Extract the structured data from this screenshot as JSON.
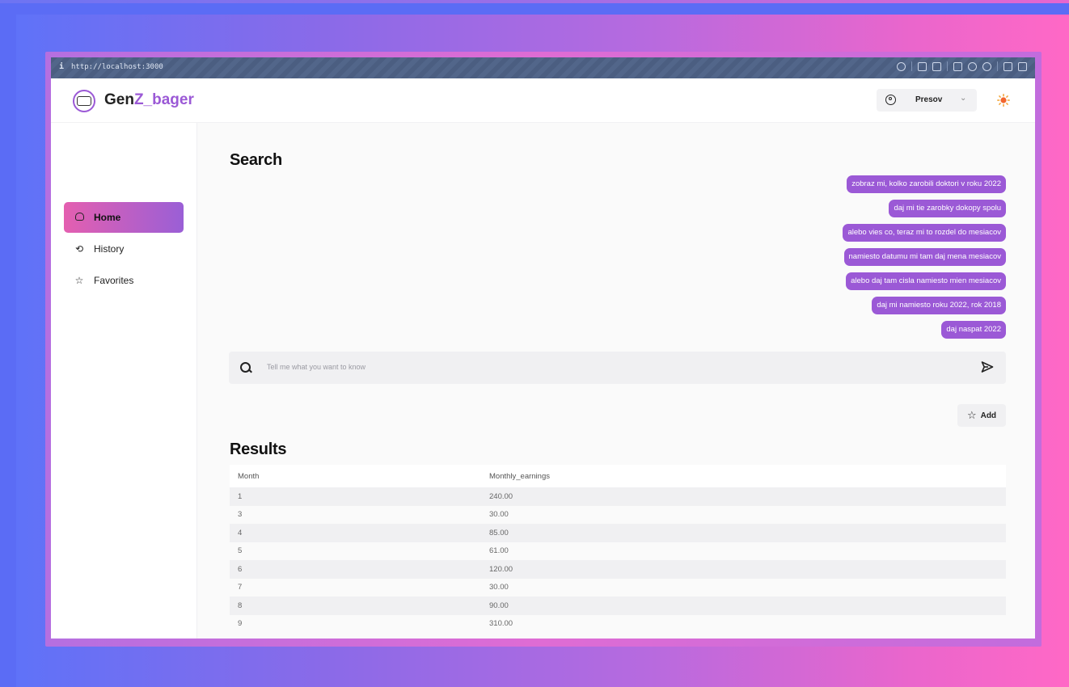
{
  "browser": {
    "info_icon": "i",
    "url": "http://localhost:3000"
  },
  "brand": {
    "prefix": "Gen",
    "suffix": "Z_bager"
  },
  "header": {
    "city_label": "Presov"
  },
  "sidebar": {
    "items": [
      {
        "label": "Home",
        "icon": "home-icon",
        "active": true
      },
      {
        "label": "History",
        "icon": "history-icon"
      },
      {
        "label": "Favorites",
        "icon": "star-icon"
      }
    ]
  },
  "search": {
    "title": "Search",
    "placeholder": "Tell me what you want to know",
    "history": [
      "zobraz mi, kolko zarobili doktori v roku 2022",
      "daj mi tie zarobky dokopy spolu",
      "alebo vies co, teraz mi to rozdel do mesiacov",
      "namiesto datumu mi tam daj mena mesiacov",
      "alebo daj tam cisla namiesto mien mesiacov",
      "daj mi namiesto roku 2022, rok 2018",
      "daj naspat 2022"
    ]
  },
  "actions": {
    "add_label": "Add"
  },
  "results": {
    "title": "Results",
    "columns": [
      "Month",
      "Monthly_earnings"
    ],
    "rows": [
      [
        "1",
        "240.00"
      ],
      [
        "3",
        "30.00"
      ],
      [
        "4",
        "85.00"
      ],
      [
        "5",
        "61.00"
      ],
      [
        "6",
        "120.00"
      ],
      [
        "7",
        "30.00"
      ],
      [
        "8",
        "90.00"
      ],
      [
        "9",
        "310.00"
      ]
    ]
  },
  "colors": {
    "accent": "#9b59d6",
    "gradient_start": "#e45fb0",
    "sun": "#f2662f"
  }
}
